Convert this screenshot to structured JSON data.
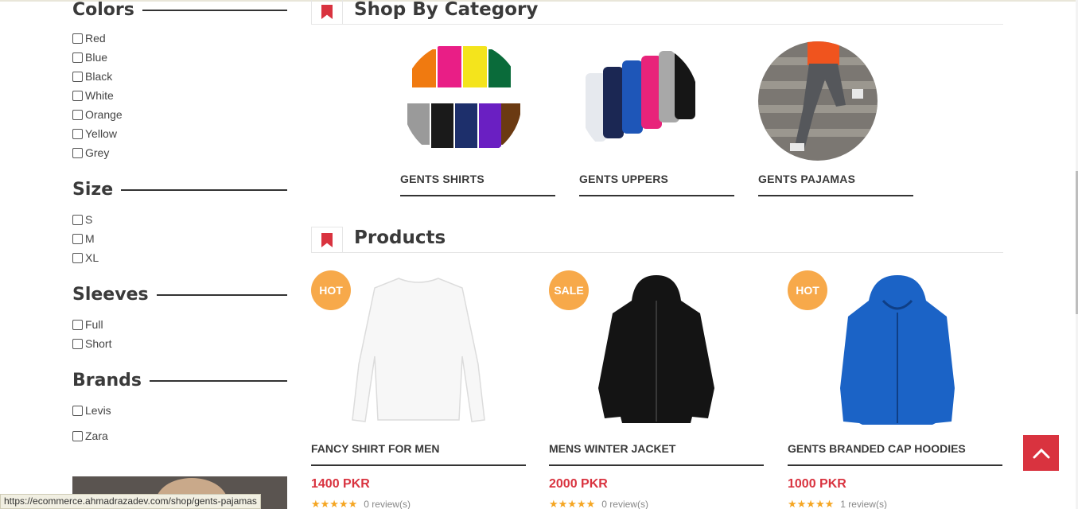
{
  "filters": {
    "colors": {
      "title": "Colors",
      "options": [
        "Red",
        "Blue",
        "Black",
        "White",
        "Orange",
        "Yellow",
        "Grey"
      ]
    },
    "size": {
      "title": "Size",
      "options": [
        "S",
        "M",
        "XL"
      ]
    },
    "sleeves": {
      "title": "Sleeves",
      "options": [
        "Full",
        "Short"
      ]
    },
    "brands": {
      "title": "Brands",
      "options": [
        "Levis",
        "Zara"
      ]
    }
  },
  "category_section": {
    "title": "Shop By Category",
    "items": [
      {
        "label": "GENTS SHIRTS"
      },
      {
        "label": "GENTS UPPERS"
      },
      {
        "label": "GENTS PAJAMAS"
      }
    ]
  },
  "products_section": {
    "title": "Products",
    "items": [
      {
        "badge": "HOT",
        "name": "FANCY SHIRT FOR MEN",
        "price": "1400 PKR",
        "rating_stars": 5,
        "reviews": "0 review(s)"
      },
      {
        "badge": "SALE",
        "name": "MENS WINTER JACKET",
        "price": "2000 PKR",
        "rating_stars": 5,
        "reviews": "0 review(s)"
      },
      {
        "badge": "HOT",
        "name": "GENTS BRANDED CAP HOODIES",
        "price": "1000 PKR",
        "rating_stars": 5,
        "reviews": "1 review(s)"
      }
    ]
  },
  "status_bar": {
    "url": "https://ecommerce.ahmadrazadev.com/shop/gents-pajamas"
  },
  "colors": {
    "accent": "#d9333f",
    "badge": "#f7a94a",
    "star": "#f5a623"
  },
  "icons": {
    "section_marker": "bookmark-icon",
    "back_to_top": "chevron-up-icon"
  }
}
